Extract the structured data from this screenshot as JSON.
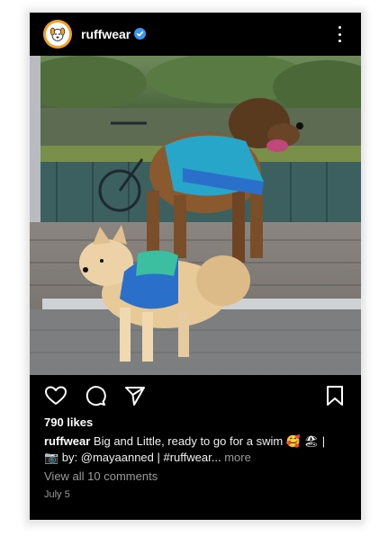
{
  "header": {
    "username": "ruffwear",
    "avatar_icon": "dog-logo-icon",
    "verified_icon": "verified-badge-icon",
    "more_icon": "more-vertical-icon"
  },
  "post": {
    "photo_icon": "dogs-on-dock-photo",
    "likes": "790 likes",
    "caption": {
      "user": "ruffwear",
      "line1": "Big and Little, ready to go for a swim 🥰 🏖 |",
      "line2": "📷 by: @mayaanned | #ruffwear",
      "ellipsis": "...",
      "more": "more"
    },
    "view_comments": "View all 10 comments",
    "date": "July 5"
  },
  "actions": {
    "like_icon": "heart-icon",
    "comment_icon": "comment-icon",
    "share_icon": "send-icon",
    "save_icon": "bookmark-icon"
  },
  "colors": {
    "background": "#000000",
    "verified": "#3897f0",
    "muted_text": "#9a9a9a",
    "avatar_ring": "#f2a126"
  }
}
